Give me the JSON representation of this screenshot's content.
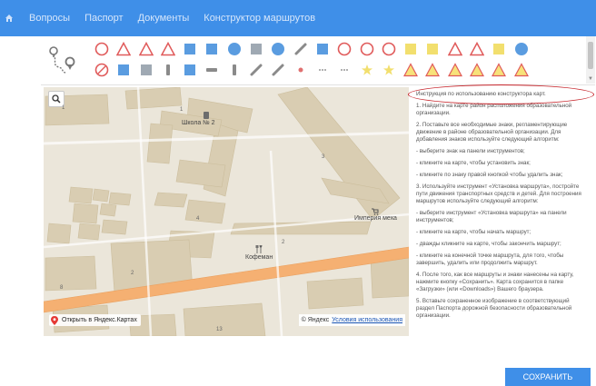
{
  "nav": {
    "home_icon": "home-icon",
    "items": [
      {
        "label": "Вопросы"
      },
      {
        "label": "Паспорт"
      },
      {
        "label": "Документы"
      },
      {
        "label": "Конструктор маршрутов"
      }
    ]
  },
  "toolbar": {
    "route_tool_icon": "route-pin-icon",
    "row1_count": 20,
    "row2_count": 20
  },
  "map": {
    "school_label": "Школа № 2",
    "shop_label": "Империя меха",
    "cafe_label": "Кофеман",
    "numbers": [
      "1",
      "1",
      "2",
      "3",
      "4",
      "2",
      "8",
      "6",
      "13",
      "15"
    ],
    "open_link": "Открыть в Яндекс.Картах",
    "copyright_prefix": "© Яндекс",
    "terms_link": "Условия использования"
  },
  "instructions": {
    "title": "Инструкция по использованию конструктора карт.",
    "paragraphs": [
      "1. Найдите на карте район расположения образовательной организации.",
      "2. Поставьте все необходимые знаки, регламентирующие движение в районе образовательной организации. Для добавления знаков используйте следующий алгоритм:",
      "- выберите знак на панели инструментов;",
      "- кликните на карте, чтобы установить знак;",
      "- кликните по знаку правой кнопкой чтобы удалить знак;",
      "3. Используйте инструмент «Установка маршрута», постройте пути движения транспортных средств и детей. Для построения маршрутов используйте следующий алгоритм:",
      "- выберите инструмент «Установка маршрута» на панели инструментов;",
      "- кликните на карте, чтобы начать маршрут;",
      "- дважды кликните на карте, чтобы закончить маршрут;",
      "- кликните на конечной точке маршрута, для того, чтобы завершить, удалить или продолжить маршрут.",
      "4. После того, как все маршруты и знаки нанесены на карту, нажмите кнопку «Сохранить». Карта сохранится в папке «Загрузки» (или «Downloads») Вашего браузера.",
      "5. Вставьте сохраненное изображение в соответствующий раздел Паспорта дорожной безопасности образовательной организации."
    ]
  },
  "save_button": {
    "label": "СОХРАНИТЬ"
  },
  "colors": {
    "nav_bg": "#3f8fe8",
    "button_bg": "#3f8fe8",
    "highlight": "#c6262c",
    "road": "#f5b072"
  }
}
